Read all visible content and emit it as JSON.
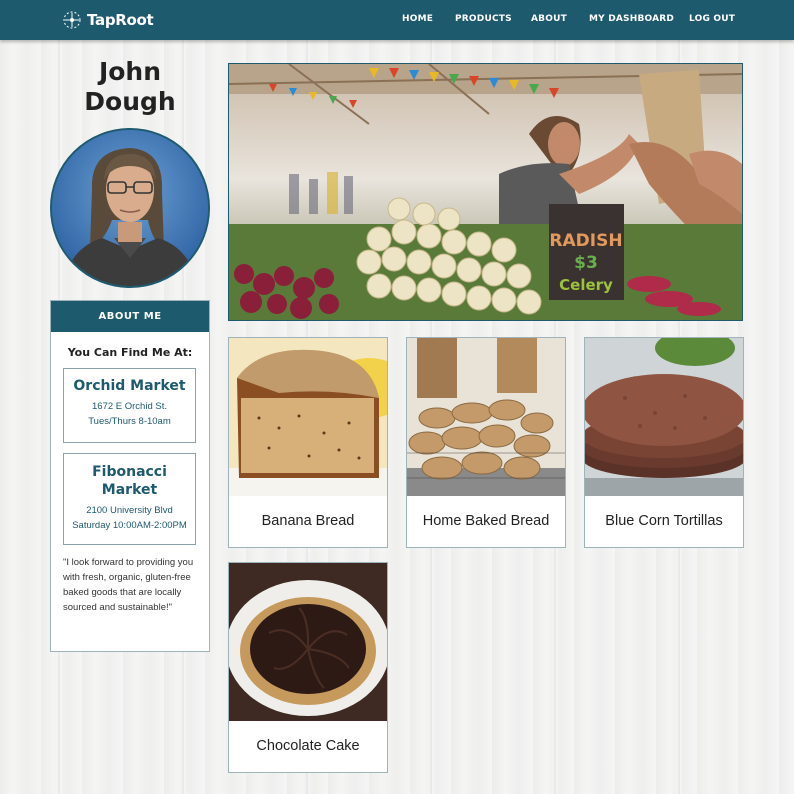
{
  "header": {
    "brand": "TapRoot",
    "nav": [
      "HOME",
      "PRODUCTS",
      "ABOUT",
      "MY DASHBOARD",
      "LOG OUT"
    ]
  },
  "profile": {
    "first_name": "John",
    "last_name": "Dough"
  },
  "about": {
    "heading": "ABOUT ME",
    "find_me": "You Can Find Me At:",
    "markets": [
      {
        "name": "Orchid Market",
        "address": "1672 E Orchid St.",
        "hours": "Tues/Thurs 8-10am"
      },
      {
        "name": "Fibonacci Market",
        "address": "2100 University Blvd",
        "hours": "Saturday 10:00AM-2:00PM"
      }
    ],
    "quote": "\"I look forward to providing you with fresh, organic, gluten-free baked goods that are locally sourced and sustainable!\""
  },
  "hero": {
    "sign_line1": "RADISH",
    "sign_line2": "$3",
    "sign_line3": "Celery"
  },
  "products": [
    {
      "name": "Banana Bread"
    },
    {
      "name": "Home Baked Bread"
    },
    {
      "name": "Blue Corn Tortillas"
    },
    {
      "name": "Chocolate Cake"
    }
  ],
  "colors": {
    "primary": "#1e5a6e",
    "background": "#f1f1f0"
  }
}
